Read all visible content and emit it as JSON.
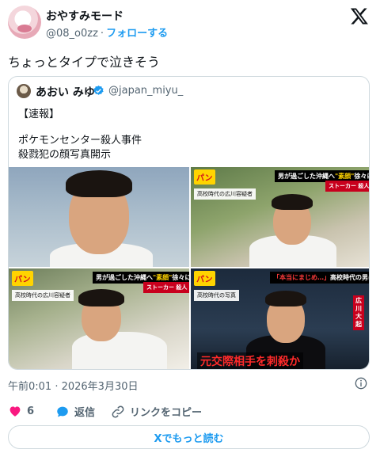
{
  "author": {
    "display_name": "おやすみモード",
    "handle": "@08_o0zz",
    "separator": "·",
    "follow_label": "フォローする"
  },
  "tweet": {
    "text": "ちょっとタイプで泣きそう",
    "timestamp": "午前0:01 · 2026年3月30日"
  },
  "quote": {
    "display_name": "あおい みゆ",
    "handle": "@japan_miyu_",
    "verified": true,
    "lines": [
      "【速報】",
      "ポケモンセンター殺人事件",
      "殺戮犯の顔写真開示"
    ]
  },
  "media": {
    "show_logo": "パン",
    "photo2": {
      "caption_prefix": "男が過ごした沖縄へ",
      "caption_highlight": "\"素顔\"",
      "caption_suffix": "徐々に",
      "sub_caption": "ストーカー 殺人",
      "label": "高校時代の広川容疑者"
    },
    "photo3": {
      "caption_prefix": "男が過ごした沖縄へ",
      "caption_highlight": "\"素顔\"",
      "caption_suffix": "徐々に",
      "sub_caption": "ストーカー 殺人",
      "label": "高校時代の広川容疑者"
    },
    "photo4": {
      "caption_quote": "「本当にまじめ…」",
      "caption_rest": "高校時代の男は",
      "label": "高校時代の写真",
      "name_vertical": "広川大起",
      "bottom_caption": "元交際相手を刺殺か"
    }
  },
  "actions": {
    "like_count": "6",
    "reply_label": "返信",
    "copy_link_label": "リンクをコピー",
    "read_more_label": "Xでもっと読む"
  },
  "colors": {
    "accent": "#1d9bf0",
    "like": "#f91880",
    "text": "#0f1419",
    "muted": "#536471",
    "border": "#cfd9de"
  },
  "icons": [
    "x-logo-icon",
    "verified-badge-icon",
    "info-icon",
    "heart-icon",
    "reply-icon",
    "link-icon"
  ]
}
